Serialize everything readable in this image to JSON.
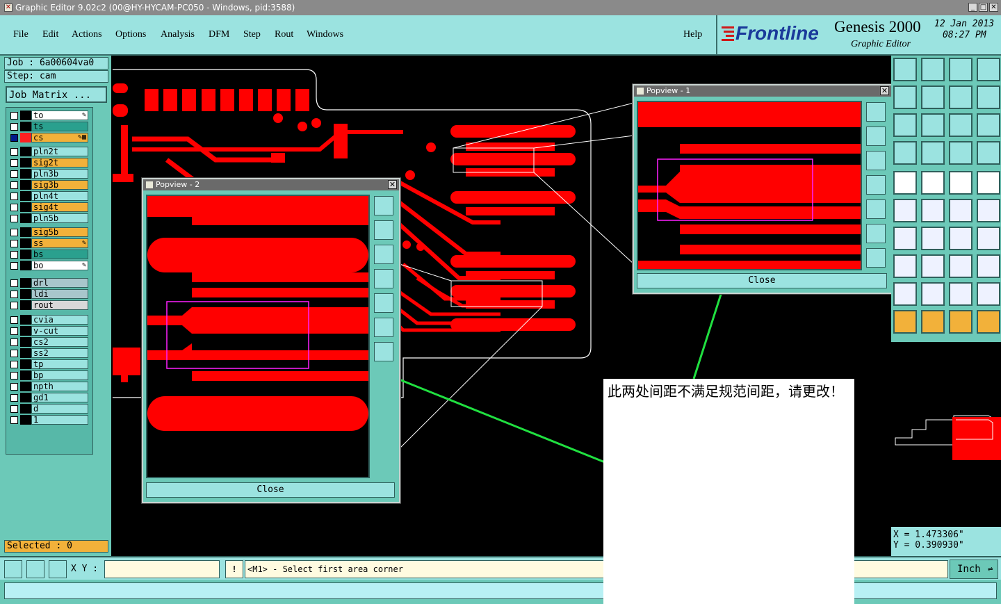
{
  "window": {
    "title": "Graphic Editor 9.02c2 (00@HY-HYCAM-PC050 - Windows, pid:3588)"
  },
  "menu": {
    "items": [
      "File",
      "Edit",
      "Actions",
      "Options",
      "Analysis",
      "DFM",
      "Step",
      "Rout",
      "Windows"
    ],
    "help": "Help"
  },
  "brand": {
    "logo": "Frontline",
    "product": "Genesis 2000",
    "subtitle": "Graphic Editor",
    "date": "12 Jan 2013",
    "time": "08:27 PM"
  },
  "job": {
    "job_label": "Job  :  6a00604va0",
    "step_label": "Step:  cam",
    "matrix_button": "Job Matrix ..."
  },
  "layers": [
    {
      "name": "to",
      "color": "#000000",
      "bg": "#ffffff",
      "checked": false,
      "flag": "edit"
    },
    {
      "name": "ts",
      "color": "#000000",
      "bg": "#2aa08e",
      "checked": false,
      "flag": ""
    },
    {
      "name": "cs",
      "color": "#ff2020",
      "bg": "#f2b13a",
      "checked": true,
      "flag": "edit2"
    },
    {
      "name": "pln2t",
      "color": "#000000",
      "bg": "#9be3e0",
      "checked": false,
      "flag": ""
    },
    {
      "name": "sig2t",
      "color": "#000000",
      "bg": "#f2b13a",
      "checked": false,
      "flag": ""
    },
    {
      "name": "pln3b",
      "color": "#000000",
      "bg": "#9be3e0",
      "checked": false,
      "flag": ""
    },
    {
      "name": "sig3b",
      "color": "#000000",
      "bg": "#f2b13a",
      "checked": false,
      "flag": ""
    },
    {
      "name": "pln4t",
      "color": "#000000",
      "bg": "#9be3e0",
      "checked": false,
      "flag": ""
    },
    {
      "name": "sig4t",
      "color": "#000000",
      "bg": "#f2b13a",
      "checked": false,
      "flag": ""
    },
    {
      "name": "pln5b",
      "color": "#000000",
      "bg": "#9be3e0",
      "checked": false,
      "flag": ""
    },
    {
      "name": "sig5b",
      "color": "#000000",
      "bg": "#f2b13a",
      "checked": false,
      "flag": ""
    },
    {
      "name": "ss",
      "color": "#000000",
      "bg": "#f2b13a",
      "checked": false,
      "flag": "edit"
    },
    {
      "name": "bs",
      "color": "#000000",
      "bg": "#2aa08e",
      "checked": false,
      "flag": ""
    },
    {
      "name": "bo",
      "color": "#000000",
      "bg": "#ffffff",
      "checked": false,
      "flag": "edit"
    },
    {
      "name": "drl",
      "color": "#000000",
      "bg": "#a8c6cc",
      "checked": false,
      "flag": ""
    },
    {
      "name": "ldi",
      "color": "#000000",
      "bg": "#a8c6cc",
      "checked": false,
      "flag": ""
    },
    {
      "name": "rout",
      "color": "#000000",
      "bg": "#d8d8d8",
      "checked": false,
      "flag": ""
    },
    {
      "name": "cvia",
      "color": "#000000",
      "bg": "#9be3e0",
      "checked": false,
      "flag": ""
    },
    {
      "name": "v-cut",
      "color": "#000000",
      "bg": "#9be3e0",
      "checked": false,
      "flag": ""
    },
    {
      "name": "cs2",
      "color": "#000000",
      "bg": "#9be3e0",
      "checked": false,
      "flag": ""
    },
    {
      "name": "ss2",
      "color": "#000000",
      "bg": "#9be3e0",
      "checked": false,
      "flag": ""
    },
    {
      "name": "tp",
      "color": "#000000",
      "bg": "#9be3e0",
      "checked": false,
      "flag": ""
    },
    {
      "name": "bp",
      "color": "#000000",
      "bg": "#9be3e0",
      "checked": false,
      "flag": ""
    },
    {
      "name": "npth",
      "color": "#000000",
      "bg": "#9be3e0",
      "checked": false,
      "flag": ""
    },
    {
      "name": "gd1",
      "color": "#000000",
      "bg": "#9be3e0",
      "checked": false,
      "flag": ""
    },
    {
      "name": "d",
      "color": "#000000",
      "bg": "#9be3e0",
      "checked": false,
      "flag": ""
    },
    {
      "name": "1",
      "color": "#000000",
      "bg": "#9be3e0",
      "checked": false,
      "flag": ""
    }
  ],
  "selected": "Selected : 0",
  "popview1": {
    "title": "Popview - 1",
    "close_label": "Close"
  },
  "popview2": {
    "title": "Popview - 2",
    "close_label": "Close"
  },
  "coords": {
    "x": "X  =  1.473306\"",
    "y": "Y  =  0.390930\""
  },
  "bottom": {
    "xy_label": "X Y :",
    "xy_value": "",
    "prompt": "<M1> - Select first area corner",
    "units": "Inch"
  },
  "note": {
    "text": "此两处间距不满足规范间距，请更改！"
  },
  "colors": {
    "copper": "#ff0000",
    "panel": "#6cc9b8",
    "light": "#9be3e0",
    "highlight": "#f2b13a"
  }
}
